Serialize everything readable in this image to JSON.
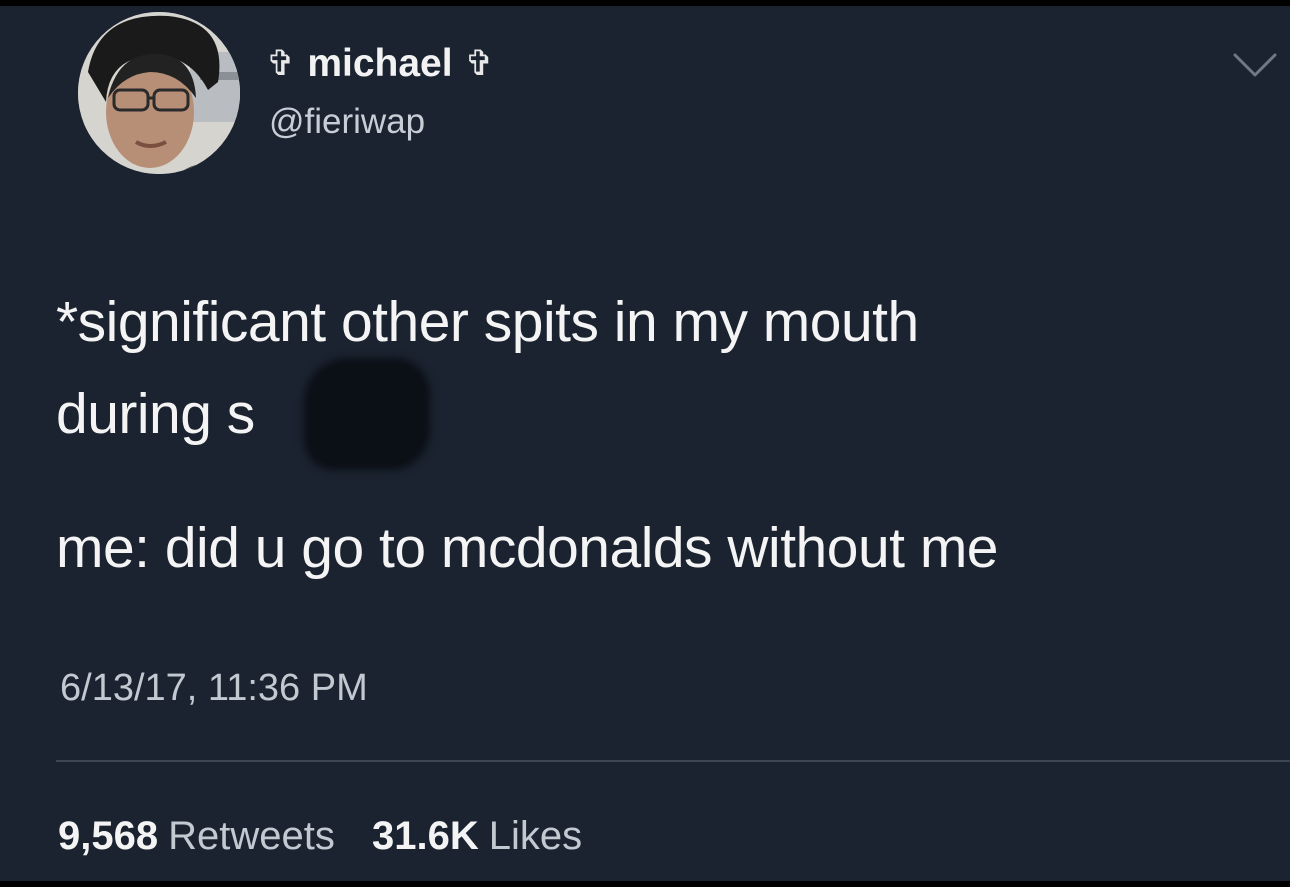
{
  "tweet": {
    "author": {
      "display_name": "michael",
      "name_decoration": "✞",
      "handle": "@fieriwap"
    },
    "text_lines": [
      "*significant other spits in my mouth",
      "during s",
      "me: did u go to mcdonalds without me"
    ],
    "timestamp": "6/13/17, 11:36 PM",
    "stats": {
      "retweets_count": "9,568",
      "retweets_label": "Retweets",
      "likes_count": "31.6K",
      "likes_label": "Likes"
    }
  },
  "icons": {
    "more_menu": "chevron-down-icon",
    "avatar": "user-avatar"
  },
  "colors": {
    "background": "#1b2330",
    "primary_text": "#f4f4f4",
    "secondary_text": "#c3c9d1",
    "divider": "#3c4654"
  }
}
